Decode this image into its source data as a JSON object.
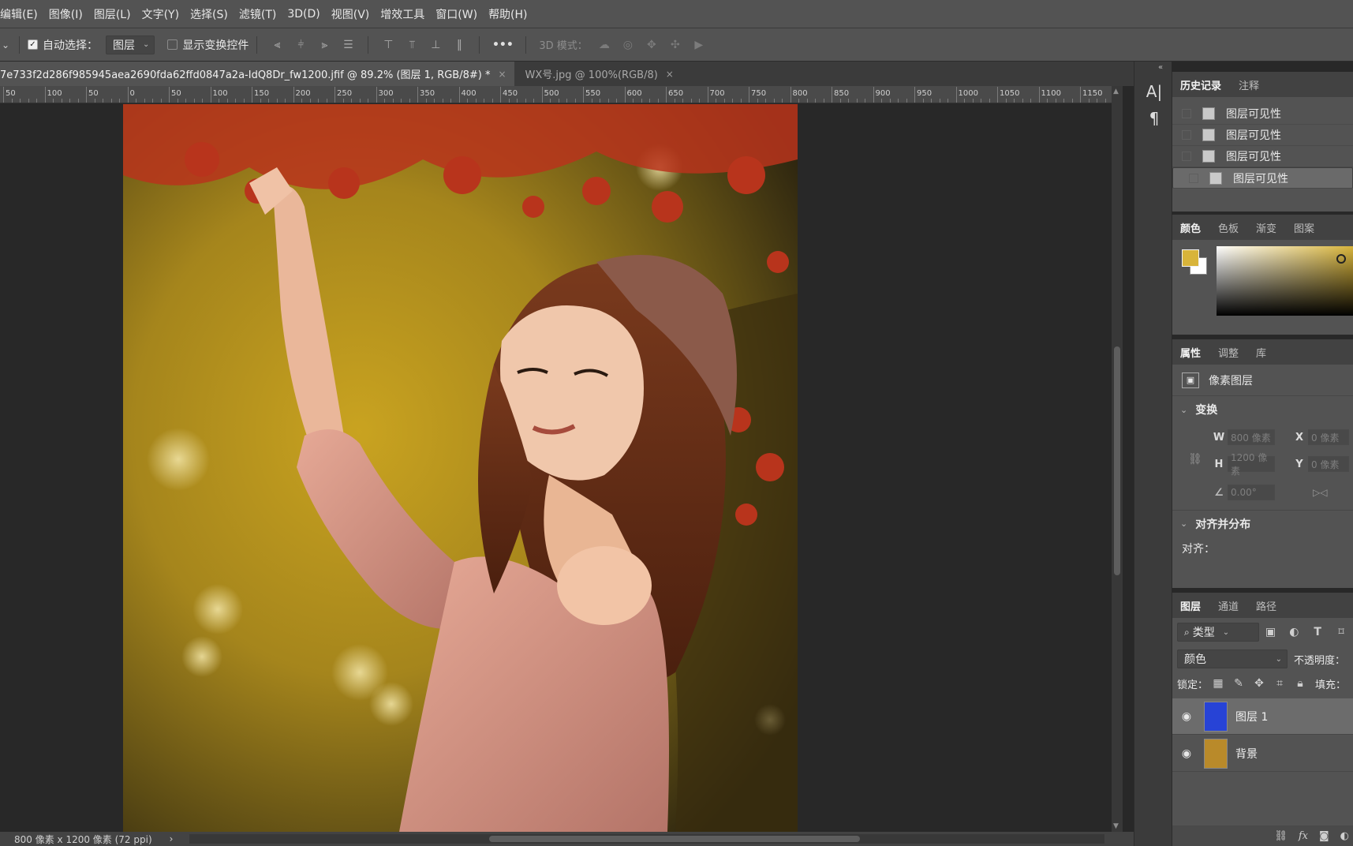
{
  "menu": [
    "编辑(E)",
    "图像(I)",
    "图层(L)",
    "文字(Y)",
    "选择(S)",
    "滤镜(T)",
    "3D(D)",
    "视图(V)",
    "增效工具",
    "窗口(W)",
    "帮助(H)"
  ],
  "options": {
    "auto_select_label": "自动选择：",
    "auto_select_target": "图层",
    "show_transform_label": "显示变换控件",
    "more": "•••",
    "mode_3d_label": "3D 模式："
  },
  "tabs": [
    {
      "label": "7e733f2d286f985945aea2690fda62ffd0847a2a-IdQ8Dr_fw1200.jfif @ 89.2% (图层 1, RGB/8#) *",
      "close": "×"
    },
    {
      "label": "WX号.jpg @ 100%(RGB/8)",
      "close": "×"
    }
  ],
  "ruler": [
    "50",
    "100",
    "50",
    "0",
    "50",
    "100",
    "150",
    "200",
    "250",
    "300",
    "350",
    "400",
    "450",
    "500",
    "550",
    "600",
    "650",
    "700",
    "750",
    "800",
    "850",
    "900",
    "950",
    "1000",
    "1050",
    "1100",
    "1150"
  ],
  "status": {
    "doc_size": "800 像素 x 1200 像素 (72 ppi)",
    "arrow": "›"
  },
  "history": {
    "tabs": [
      "历史记录",
      "注释"
    ],
    "items": [
      "图层可见性",
      "图层可见性",
      "图层可见性",
      "图层可见性"
    ]
  },
  "color_panel": {
    "tabs": [
      "颜色",
      "色板",
      "渐变",
      "图案"
    ],
    "foreground": "#d8b43a",
    "background": "#ffffff"
  },
  "properties": {
    "tabs": [
      "属性",
      "调整",
      "库"
    ],
    "layer_type": "像素图层",
    "transform_title": "变换",
    "w_label": "W",
    "w_value": "800 像素",
    "x_label": "X",
    "x_value": "0 像素",
    "h_label": "H",
    "h_value": "1200 像素",
    "y_label": "Y",
    "y_value": "0 像素",
    "angle_value": "0.00°",
    "align_title": "对齐并分布",
    "align_label": "对齐："
  },
  "layers": {
    "tabs": [
      "图层",
      "通道",
      "路径"
    ],
    "filter": "类型",
    "blend_mode": "颜色",
    "opacity_label": "不透明度：",
    "lock_label": "锁定：",
    "fill_label": "填充：",
    "items": [
      {
        "name": "图层 1",
        "thumb": "#2743d6",
        "active": true
      },
      {
        "name": "背景",
        "thumb": "#b98a2a",
        "active": false
      }
    ],
    "footer": [
      "fx"
    ]
  }
}
